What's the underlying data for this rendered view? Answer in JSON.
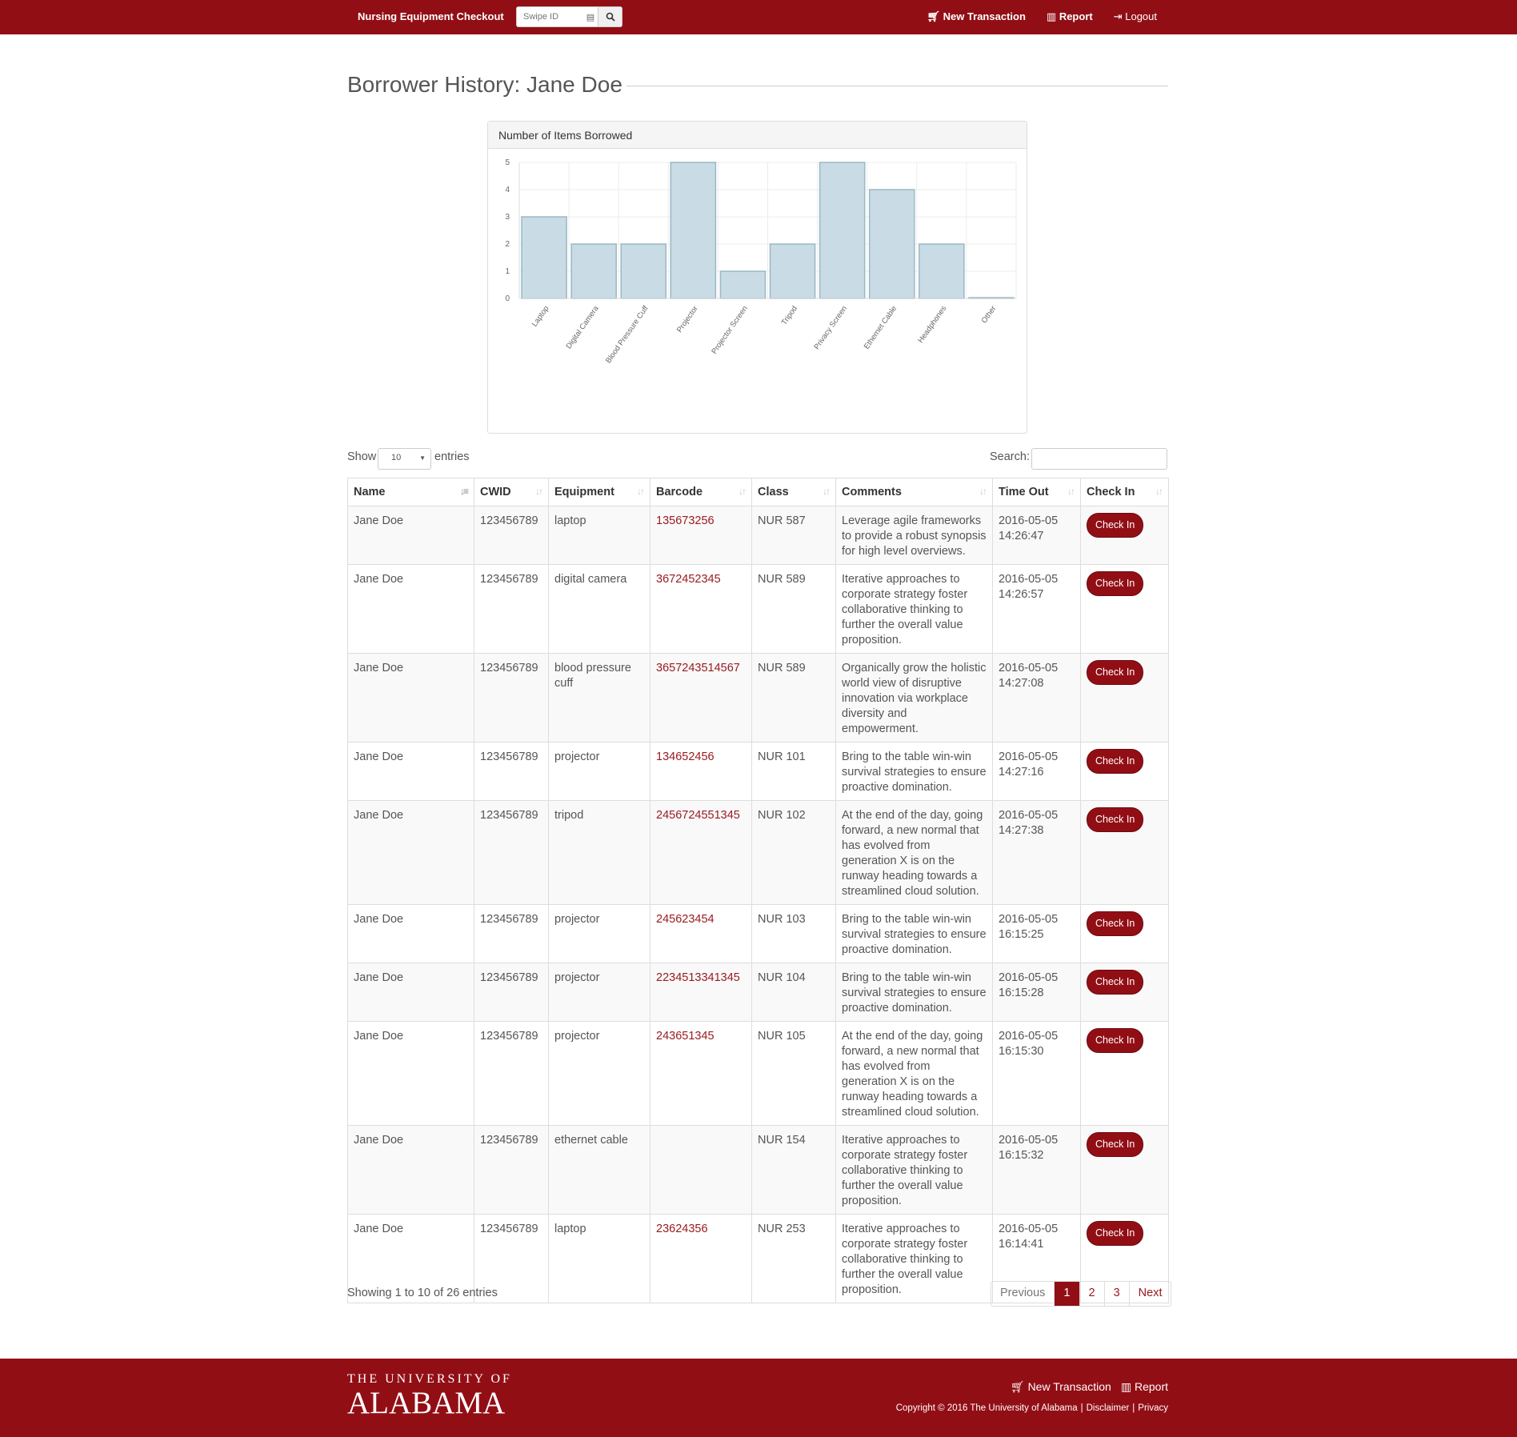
{
  "nav": {
    "brand": "Nursing Equipment Checkout",
    "swipe_placeholder": "Swipe ID",
    "new_transaction": "New Transaction",
    "report": "Report",
    "logout": "Logout"
  },
  "page": {
    "title": "Borrower History: Jane Doe"
  },
  "chart_panel": {
    "heading": "Number of Items Borrowed"
  },
  "chart_data": {
    "type": "bar",
    "categories": [
      "Laptop",
      "Digital Camera",
      "Blood Pressure Cuff",
      "Projector",
      "Projector Screen",
      "Tripod",
      "Privacy Screen",
      "Ethernet Cable",
      "Headphones",
      "Other"
    ],
    "values": [
      3,
      2,
      2,
      5,
      1,
      2,
      5,
      4,
      2,
      0
    ],
    "ylim": [
      0,
      5
    ],
    "yticks": [
      "0",
      "1",
      "2",
      "3",
      "4",
      "5"
    ],
    "grid": true,
    "bar_fill": "#c9dbe4",
    "bar_stroke": "#9ab8c6"
  },
  "controls": {
    "show_label": "Show",
    "page_size": "10",
    "entries_label": "entries",
    "search_label": "Search:",
    "search_value": ""
  },
  "table": {
    "columns": [
      "Name",
      "CWID",
      "Equipment",
      "Barcode",
      "Class",
      "Comments",
      "Time Out",
      "Check In"
    ],
    "rows": [
      {
        "name": "Jane Doe",
        "cwid": "123456789",
        "equipment": "laptop",
        "barcode": "135673256",
        "class": "NUR 587",
        "comments": "Leverage agile frameworks to provide a robust synopsis for high level overviews.",
        "time_date": "2016-05-05",
        "time_clock": "14:26:47",
        "action": "Check In"
      },
      {
        "name": "Jane Doe",
        "cwid": "123456789",
        "equipment": "digital camera",
        "barcode": "3672452345",
        "class": "NUR 589",
        "comments": "Iterative approaches to corporate strategy foster collaborative thinking to further the overall value proposition.",
        "time_date": "2016-05-05",
        "time_clock": "14:26:57",
        "action": "Check In"
      },
      {
        "name": "Jane Doe",
        "cwid": "123456789",
        "equipment": "blood pressure cuff",
        "barcode": "3657243514567",
        "class": "NUR 589",
        "comments": "Organically grow the holistic world view of disruptive innovation via workplace diversity and empowerment.",
        "time_date": "2016-05-05",
        "time_clock": "14:27:08",
        "action": "Check In"
      },
      {
        "name": "Jane Doe",
        "cwid": "123456789",
        "equipment": "projector",
        "barcode": "134652456",
        "class": "NUR 101",
        "comments": "Bring to the table win-win survival strategies to ensure proactive domination.",
        "time_date": "2016-05-05",
        "time_clock": "14:27:16",
        "action": "Check In"
      },
      {
        "name": "Jane Doe",
        "cwid": "123456789",
        "equipment": "tripod",
        "barcode": "2456724551345",
        "class": "NUR 102",
        "comments": "At the end of the day, going forward, a new normal that has evolved from generation X is on the runway heading towards a streamlined cloud solution.",
        "time_date": "2016-05-05",
        "time_clock": "14:27:38",
        "action": "Check In"
      },
      {
        "name": "Jane Doe",
        "cwid": "123456789",
        "equipment": "projector",
        "barcode": "245623454",
        "class": "NUR 103",
        "comments": "Bring to the table win-win survival strategies to ensure proactive domination.",
        "time_date": "2016-05-05",
        "time_clock": "16:15:25",
        "action": "Check In"
      },
      {
        "name": "Jane Doe",
        "cwid": "123456789",
        "equipment": "projector",
        "barcode": "2234513341345",
        "class": "NUR 104",
        "comments": "Bring to the table win-win survival strategies to ensure proactive domination.",
        "time_date": "2016-05-05",
        "time_clock": "16:15:28",
        "action": "Check In"
      },
      {
        "name": "Jane Doe",
        "cwid": "123456789",
        "equipment": "projector",
        "barcode": "243651345",
        "class": "NUR 105",
        "comments": "At the end of the day, going forward, a new normal that has evolved from generation X is on the runway heading towards a streamlined cloud solution.",
        "time_date": "2016-05-05",
        "time_clock": "16:15:30",
        "action": "Check In"
      },
      {
        "name": "Jane Doe",
        "cwid": "123456789",
        "equipment": "ethernet cable",
        "barcode": "",
        "class": "NUR 154",
        "comments": "Iterative approaches to corporate strategy foster collaborative thinking to further the overall value proposition.",
        "time_date": "2016-05-05",
        "time_clock": "16:15:32",
        "action": "Check In"
      },
      {
        "name": "Jane Doe",
        "cwid": "123456789",
        "equipment": "laptop",
        "barcode": "23624356",
        "class": "NUR 253",
        "comments": "Iterative approaches to corporate strategy foster collaborative thinking to further the overall value proposition.",
        "time_date": "2016-05-05",
        "time_clock": "16:14:41",
        "action": "Check In"
      }
    ]
  },
  "pagination": {
    "info": "Showing 1 to 10 of 26 entries",
    "previous": "Previous",
    "pages": [
      "1",
      "2",
      "3"
    ],
    "current": "1",
    "next": "Next"
  },
  "footer": {
    "logo_line1": "THE UNIVERSITY OF",
    "logo_line2": "ALABAMA",
    "new_transaction": "New Transaction",
    "report": "Report",
    "copyright": "Copyright © 2016 The University of Alabama",
    "disclaimer": "Disclaimer",
    "privacy": "Privacy"
  },
  "colors": {
    "brand": "#920e15",
    "link": "#9a1b20"
  }
}
